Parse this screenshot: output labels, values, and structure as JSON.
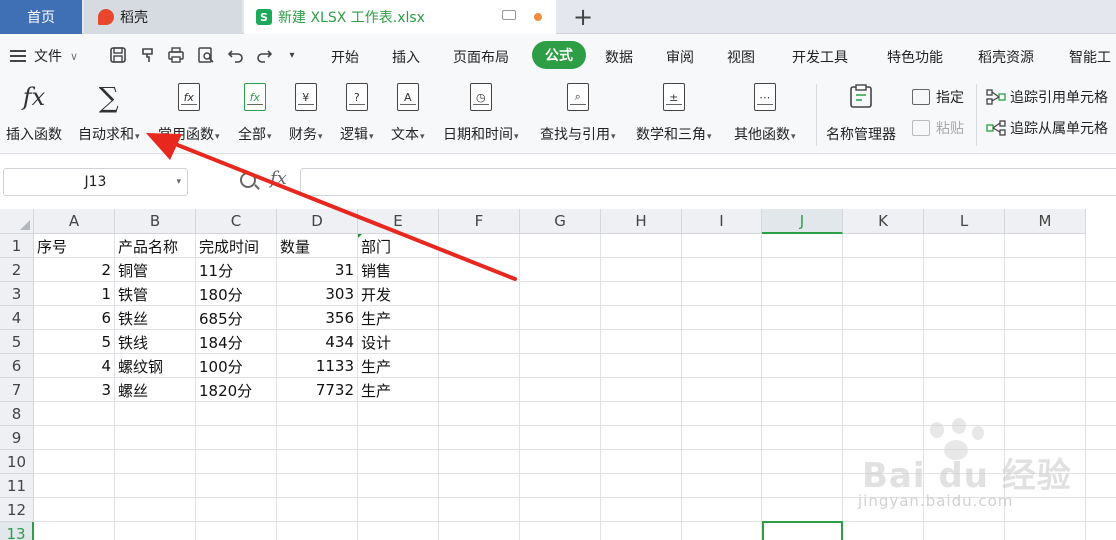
{
  "tabs": {
    "home": "首页",
    "daoke": "稻壳",
    "file": "新建 XLSX 工作表.xlsx",
    "add": "+"
  },
  "menu": {
    "file_label": "文件",
    "items": [
      "开始",
      "插入",
      "页面布局",
      "公式",
      "数据",
      "审阅",
      "视图",
      "开发工具",
      "特色功能",
      "稻壳资源",
      "智能工"
    ],
    "active": "公式"
  },
  "ribbon": {
    "insert_function": "插入函数",
    "autosum": "自动求和",
    "common": "常用函数",
    "all": "全部",
    "finance": "财务",
    "logic": "逻辑",
    "text": "文本",
    "datetime": "日期和时间",
    "lookup": "查找与引用",
    "math": "数学和三角",
    "other": "其他函数",
    "name_manager": "名称管理器",
    "assign": "指定",
    "paste": "粘贴",
    "trace_precedents": "追踪引用单元格",
    "trace_dependents": "追踪从属单元格"
  },
  "formula_bar": {
    "name_box": "J13",
    "fx": "fx",
    "value": ""
  },
  "grid": {
    "columns": [
      "A",
      "B",
      "C",
      "D",
      "E",
      "F",
      "G",
      "H",
      "I",
      "J",
      "K",
      "L",
      "M"
    ],
    "selected_column": "J",
    "rows": [
      "1",
      "2",
      "3",
      "4",
      "5",
      "6",
      "7",
      "8",
      "9",
      "10",
      "11",
      "12",
      "13"
    ],
    "selected_row": "13",
    "header": [
      "序号",
      "产品名称",
      "完成时间",
      "数量",
      "部门"
    ],
    "data": [
      [
        "2",
        "铜管",
        "11分",
        "31",
        "销售"
      ],
      [
        "1",
        "铁管",
        "180分",
        "303",
        "开发"
      ],
      [
        "6",
        "铁丝",
        "685分",
        "356",
        "生产"
      ],
      [
        "5",
        "铁线",
        "184分",
        "434",
        "设计"
      ],
      [
        "4",
        "螺纹钢",
        "100分",
        "1133",
        "生产"
      ],
      [
        "3",
        "螺丝",
        "1820分",
        "7732",
        "生产"
      ]
    ]
  },
  "watermark": {
    "brand": "Bai du 经验",
    "url": "jingyan.baidu.com"
  },
  "colors": {
    "accent_green": "#2e9e46",
    "home_tab": "#3f6fb5",
    "arrow_red": "#e8271f"
  }
}
